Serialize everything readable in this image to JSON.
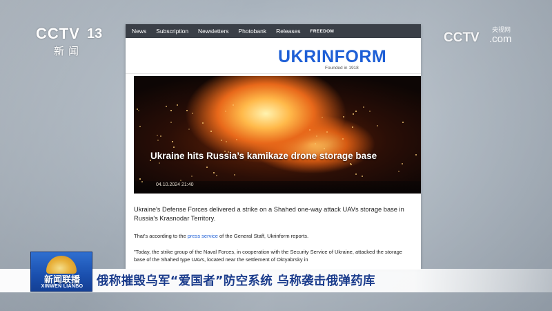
{
  "channel": {
    "brand": "CCTV",
    "number": "13",
    "subtitle": "新闻"
  },
  "watermark": {
    "brand": "CCTV",
    "domain": ".com",
    "chinese": "央视网"
  },
  "webpage": {
    "nav": [
      "News",
      "Subscription",
      "Newsletters",
      "Photobank",
      "Releases",
      "FREEDOM"
    ],
    "logo": "UKRINFORM",
    "founded": "Founded in 1918",
    "hero": {
      "title": "Ukraine hits Russia’s kamikaze drone storage base",
      "date": "04.10.2024 21:40"
    },
    "lead": "Ukraine's Defense Forces delivered a strike on a Shahed one-way attack UAVs storage base in Russia's Krasnodar Territory.",
    "p2": {
      "before": "That's according to the ",
      "link": "press service",
      "after": " of the General Staff, Ukrinform reports."
    },
    "p3": "\"Today, the strike group of the Naval Forces, in cooperation with the Security Service of Ukraine, attacked the storage base of the Shahed type UAVs, located near the settlement of Oktyabrsky in"
  },
  "program": {
    "name_cn": "新闻联播",
    "name_en": "XINWEN LIANBO"
  },
  "caption": "俄称摧毁乌军“爱国者”防空系统 乌称袭击俄弹药库",
  "colors": {
    "logo_blue": "#1e5fd6",
    "caption_text": "#1b3c8c",
    "nav_bg": "#3a3f47"
  }
}
